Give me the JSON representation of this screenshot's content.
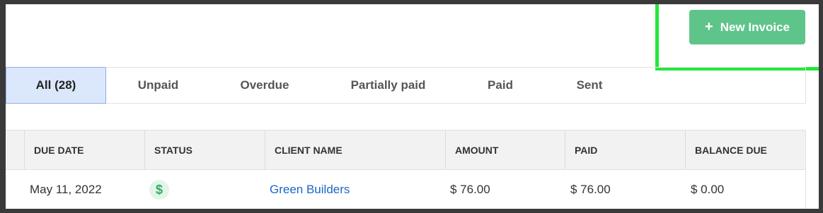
{
  "toolbar": {
    "new_invoice_label": "New Invoice",
    "new_invoice_icon": "plus-icon",
    "button_color": "#5fc48a"
  },
  "highlight_color": "#22e83a",
  "tabs": [
    {
      "label": "All (28)",
      "active": true
    },
    {
      "label": "Unpaid",
      "active": false
    },
    {
      "label": "Overdue",
      "active": false
    },
    {
      "label": "Partially paid",
      "active": false
    },
    {
      "label": "Paid",
      "active": false
    },
    {
      "label": "Sent",
      "active": false
    }
  ],
  "table": {
    "columns": [
      "DUE DATE",
      "STATUS",
      "CLIENT NAME",
      "AMOUNT",
      "PAID",
      "BALANCE DUE"
    ],
    "rows": [
      {
        "due_date": "May 11, 2022",
        "status_icon": "$",
        "status": "dollar-icon",
        "client_name": "Green Builders",
        "amount": "$ 76.00",
        "paid": "$ 76.00",
        "balance_due": "$ 0.00"
      }
    ]
  }
}
